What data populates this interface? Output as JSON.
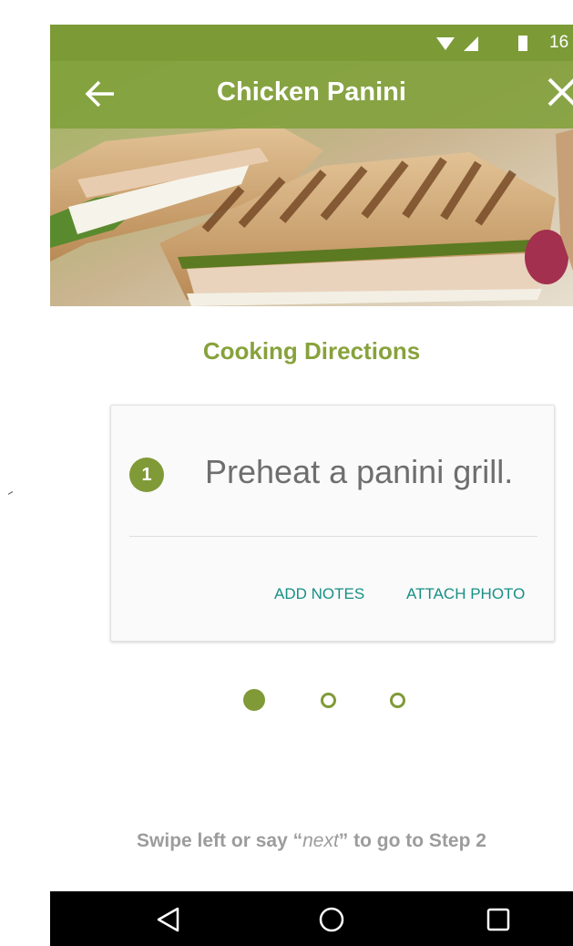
{
  "status_bar": {
    "time": "16",
    "icons": [
      "wifi-icon",
      "signal-icon",
      "battery-icon"
    ]
  },
  "app_bar": {
    "title": "Chicken Panini",
    "back_icon": "arrow-left-icon",
    "close_icon": "close-icon"
  },
  "hero_image": "chicken-panini-photo",
  "section": {
    "title": "Cooking Directions"
  },
  "step_card": {
    "number": "1",
    "text": "Preheat a panini grill.",
    "actions": {
      "add_notes": "ADD NOTES",
      "attach_photo": "ATTACH PHOTO"
    }
  },
  "pager": {
    "total": 3,
    "current": 1
  },
  "hint": {
    "prefix": "Swipe left or say “",
    "keyword": "next",
    "suffix": "” to  go to Step 2"
  },
  "nav_bar": {
    "icons": [
      "back-triangle-icon",
      "home-circle-icon",
      "recents-square-icon"
    ]
  },
  "colors": {
    "brand_green": "#809a38",
    "accent_teal": "#178f84",
    "hint_gray": "#9c9c9c"
  }
}
